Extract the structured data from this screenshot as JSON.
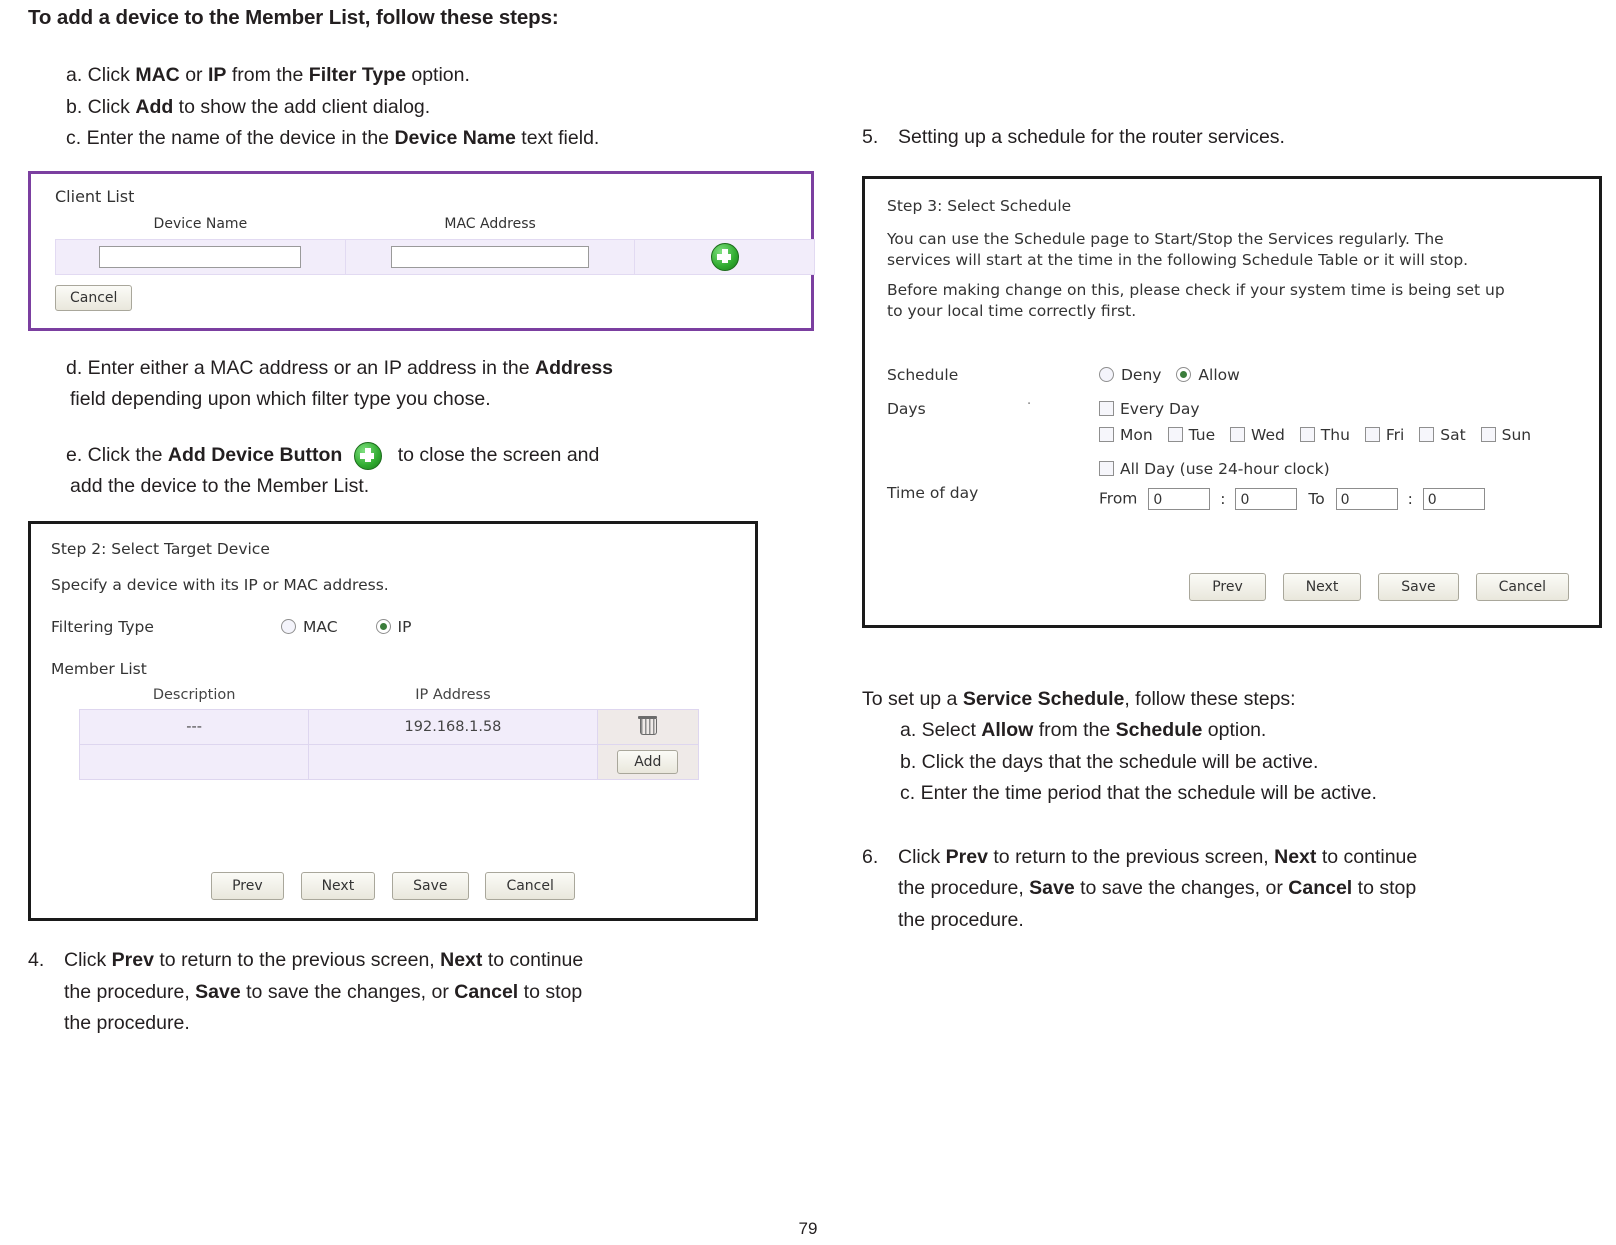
{
  "heading": "To add a device to the Member List, follow these steps:",
  "left": {
    "steps": [
      {
        "prefix": "a. Click ",
        "b1": "MAC",
        "mid1": " or ",
        "b2": "IP",
        "mid2": " from the ",
        "b3": "Filter Type",
        "suffix": " option."
      },
      {
        "prefix": "b. Click ",
        "b1": "Add",
        "mid1": " to show the add client dialog.",
        "b2": "",
        "mid2": "",
        "b3": "",
        "suffix": ""
      },
      {
        "prefix": "c. Enter the name of the device in the ",
        "b1": "Device Name",
        "mid1": " text field.",
        "b2": "",
        "mid2": "",
        "b3": "",
        "suffix": ""
      }
    ],
    "step_d": {
      "line1_pre": "d. Enter either a MAC address or an IP address in the ",
      "line1_bold": "Address",
      "line2": "field depending upon which filter type you chose."
    },
    "step_e": {
      "line1_pre": "e. Click the ",
      "line1_bold": "Add Device Button",
      "line1_post": " to close the screen and",
      "line2": "add the device to the Member List."
    },
    "step4": {
      "num": "4.",
      "t1": "Click ",
      "b1": "Prev",
      "t2": " to return to the previous screen, ",
      "b2": "Next",
      "t3": " to continue",
      "t4": "the procedure, ",
      "b3": "Save",
      "t5": " to save the changes, or ",
      "b4": "Cancel",
      "t6": " to stop",
      "t7": "the procedure."
    }
  },
  "client_list": {
    "title": "Client List",
    "col_device_name": "Device Name",
    "col_mac_address": "MAC Address",
    "device_name_value": "",
    "mac_address_value": "",
    "add_icon": "plus-circle-icon",
    "cancel_label": "Cancel"
  },
  "step2": {
    "title": "Step 2: Select Target Device",
    "subtitle": "Specify a device with its IP or MAC address.",
    "filtering_type_label": "Filtering Type",
    "options": [
      {
        "label": "MAC",
        "selected": false
      },
      {
        "label": "IP",
        "selected": true
      }
    ],
    "member_list_label": "Member List",
    "columns": [
      "Description",
      "IP Address",
      ""
    ],
    "rows": [
      {
        "description": "---",
        "ip": "192.168.1.58",
        "action": "delete-icon"
      },
      {
        "description": "",
        "ip": "",
        "action": "Add"
      }
    ],
    "add_label": "Add",
    "buttons": [
      "Prev",
      "Next",
      "Save",
      "Cancel"
    ]
  },
  "step3": {
    "title": "Step 3: Select Schedule",
    "para1_line1": "You can use the Schedule page to Start/Stop the Services regularly. The",
    "para1_line2": "services will start at the time in the following Schedule Table or it will stop.",
    "para2_line1": "Before making change on this, please check if your system time is being set up",
    "para2_line2": "to your local time correctly first.",
    "schedule_label": "Schedule",
    "schedule_options": [
      {
        "label": "Deny",
        "selected": false
      },
      {
        "label": "Allow",
        "selected": true
      }
    ],
    "days_label": "Days",
    "every_day_label": "Every Day",
    "days": [
      "Mon",
      "Tue",
      "Wed",
      "Thu",
      "Fri",
      "Sat",
      "Sun"
    ],
    "time_of_day_label": "Time of day",
    "all_day_label": "All Day (use 24-hour clock)",
    "from_label": "From",
    "to_label": "To",
    "from_hour": "0",
    "from_min": "0",
    "to_hour": "0",
    "to_min": "0",
    "colon": ":",
    "buttons": [
      "Prev",
      "Next",
      "Save",
      "Cancel"
    ]
  },
  "right": {
    "step5": {
      "num": "5.",
      "text": "Setting up a schedule for the router services."
    },
    "service_schedule": {
      "intro_pre": "To set up a ",
      "intro_bold": "Service Schedule",
      "intro_post": ", follow these steps:",
      "a_pre": "a. Select ",
      "a_b1": "Allow",
      "a_mid": " from the ",
      "a_b2": "Schedule",
      "a_post": " option.",
      "b": "b. Click the days that the schedule will be active.",
      "c": "c. Enter the time period that the schedule will be active."
    },
    "step6": {
      "num": "6.",
      "t1": "Click ",
      "b1": "Prev",
      "t2": " to return to the previous screen, ",
      "b2": "Next",
      "t3": " to continue",
      "t4": "the procedure, ",
      "b3": "Save",
      "t5": " to save the changes, or ",
      "b4": "Cancel",
      "t6": " to stop",
      "t7": "the procedure."
    }
  },
  "footer": {
    "page_number": "79"
  }
}
